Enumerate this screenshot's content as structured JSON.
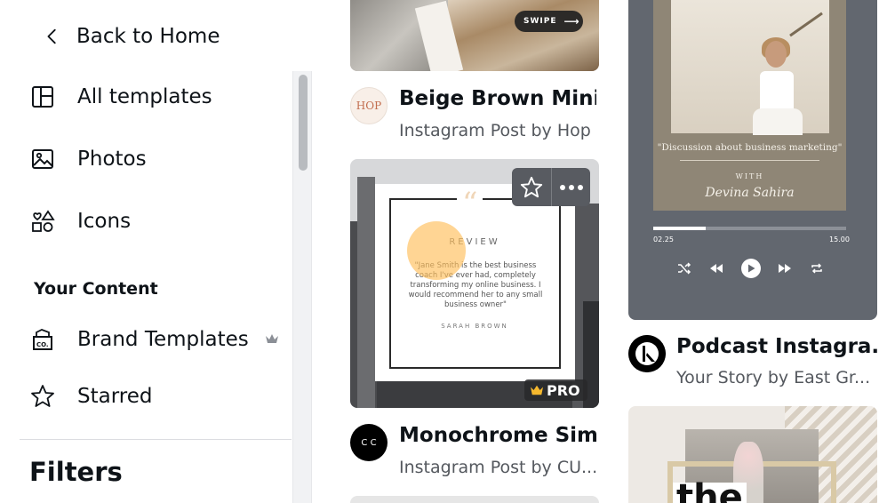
{
  "sidebar": {
    "back_label": "Back to Home",
    "nav": [
      {
        "label": "All templates",
        "icon": "layout-icon"
      },
      {
        "label": "Photos",
        "icon": "image-icon"
      },
      {
        "label": "Icons",
        "icon": "shapes-icon"
      }
    ],
    "your_content_title": "Your Content",
    "content_items": [
      {
        "label": "Brand Templates",
        "icon": "brand-kit-icon",
        "premium": true
      },
      {
        "label": "Starred",
        "icon": "star-icon"
      }
    ],
    "filters_title": "Filters"
  },
  "cards": [
    {
      "title": "Beige Brown Mini...",
      "subtitle": "Instagram Post by Hop",
      "avatar_text": "HOP",
      "thumb_text": "SWIPE"
    },
    {
      "title": "Monochrome Sim...",
      "subtitle": "Instagram Post by CU...",
      "avatar_text": "C C",
      "badge": "PRO",
      "review": {
        "title": "REVIEW",
        "text": "\"Jane Smith is the best business coach I've ever had, completely transforming my online business. I would recommend her to any small business owner\"",
        "author": "SARAH BROWN"
      }
    },
    {
      "title": "Podcast Instagra...",
      "subtitle": "Your Story by East Gr...",
      "podcast": {
        "quote": "\"Discussion about business marketing\"",
        "with": "WITH",
        "host": "Devina Sahira",
        "time_start": "02.25",
        "time_end": "15.00",
        "progress": 0.27
      }
    },
    {
      "thumb_text": "the"
    }
  ],
  "colors": {
    "accent_touch": "#ffbe5a",
    "podcast_bg": "#62676f",
    "text": "#0e1318",
    "muted": "#54585e"
  }
}
